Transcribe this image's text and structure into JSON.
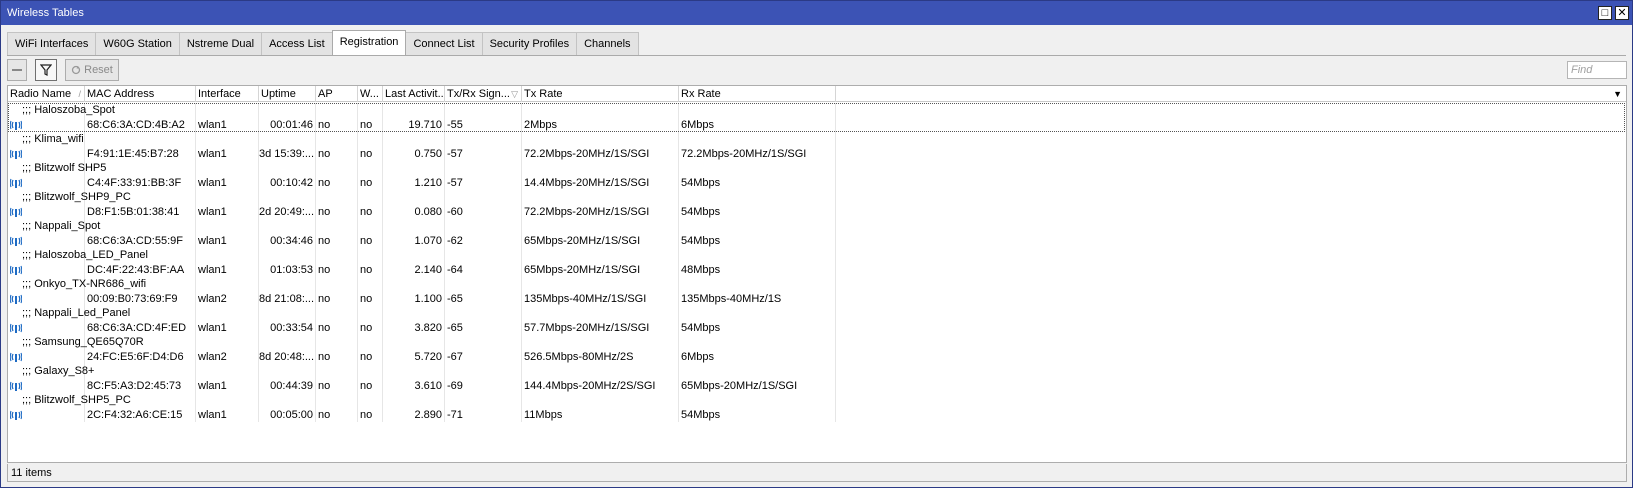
{
  "window": {
    "title": "Wireless Tables"
  },
  "tabs": [
    {
      "label": "WiFi Interfaces",
      "active": false
    },
    {
      "label": "W60G Station",
      "active": false
    },
    {
      "label": "Nstreme Dual",
      "active": false
    },
    {
      "label": "Access List",
      "active": false
    },
    {
      "label": "Registration",
      "active": true
    },
    {
      "label": "Connect List",
      "active": false
    },
    {
      "label": "Security Profiles",
      "active": false
    },
    {
      "label": "Channels",
      "active": false
    }
  ],
  "toolbar": {
    "reset_label": "Reset",
    "find_placeholder": "Find"
  },
  "columns": [
    "Radio Name",
    "MAC Address",
    "Interface",
    "Uptime",
    "AP",
    "W...",
    "Last Activit...",
    "Tx/Rx Sign...",
    "Tx Rate",
    "Rx Rate"
  ],
  "rows": [
    {
      "comment": ";;; Haloszoba_Spot",
      "mac": "68:C6:3A:CD:4B:A2",
      "iface": "wlan1",
      "uptime": "00:01:46",
      "ap": "no",
      "w": "no",
      "last": "19.710",
      "signal": "-55",
      "tx": "2Mbps",
      "rx": "6Mbps"
    },
    {
      "comment": ";;; Klima_wifi",
      "mac": "F4:91:1E:45:B7:28",
      "iface": "wlan1",
      "uptime": "3d 15:39:...",
      "ap": "no",
      "w": "no",
      "last": "0.750",
      "signal": "-57",
      "tx": "72.2Mbps-20MHz/1S/SGI",
      "rx": "72.2Mbps-20MHz/1S/SGI"
    },
    {
      "comment": ";;; Blitzwolf SHP5",
      "mac": "C4:4F:33:91:BB:3F",
      "iface": "wlan1",
      "uptime": "00:10:42",
      "ap": "no",
      "w": "no",
      "last": "1.210",
      "signal": "-57",
      "tx": "14.4Mbps-20MHz/1S/SGI",
      "rx": "54Mbps"
    },
    {
      "comment": ";;; Blitzwolf_SHP9_PC",
      "mac": "D8:F1:5B:01:38:41",
      "iface": "wlan1",
      "uptime": "2d 20:49:...",
      "ap": "no",
      "w": "no",
      "last": "0.080",
      "signal": "-60",
      "tx": "72.2Mbps-20MHz/1S/SGI",
      "rx": "54Mbps"
    },
    {
      "comment": ";;; Nappali_Spot",
      "mac": "68:C6:3A:CD:55:9F",
      "iface": "wlan1",
      "uptime": "00:34:46",
      "ap": "no",
      "w": "no",
      "last": "1.070",
      "signal": "-62",
      "tx": "65Mbps-20MHz/1S/SGI",
      "rx": "54Mbps"
    },
    {
      "comment": ";;; Haloszoba_LED_Panel",
      "mac": "DC:4F:22:43:BF:AA",
      "iface": "wlan1",
      "uptime": "01:03:53",
      "ap": "no",
      "w": "no",
      "last": "2.140",
      "signal": "-64",
      "tx": "65Mbps-20MHz/1S/SGI",
      "rx": "48Mbps"
    },
    {
      "comment": ";;; Onkyo_TX-NR686_wifi",
      "mac": "00:09:B0:73:69:F9",
      "iface": "wlan2",
      "uptime": "8d 21:08:...",
      "ap": "no",
      "w": "no",
      "last": "1.100",
      "signal": "-65",
      "tx": "135Mbps-40MHz/1S/SGI",
      "rx": "135Mbps-40MHz/1S"
    },
    {
      "comment": ";;; Nappali_Led_Panel",
      "mac": "68:C6:3A:CD:4F:ED",
      "iface": "wlan1",
      "uptime": "00:33:54",
      "ap": "no",
      "w": "no",
      "last": "3.820",
      "signal": "-65",
      "tx": "57.7Mbps-20MHz/1S/SGI",
      "rx": "54Mbps"
    },
    {
      "comment": ";;; Samsung_QE65Q70R",
      "mac": "24:FC:E5:6F:D4:D6",
      "iface": "wlan2",
      "uptime": "8d 20:48:...",
      "ap": "no",
      "w": "no",
      "last": "5.720",
      "signal": "-67",
      "tx": "526.5Mbps-80MHz/2S",
      "rx": "6Mbps"
    },
    {
      "comment": ";;; Galaxy_S8+",
      "mac": "8C:F5:A3:D2:45:73",
      "iface": "wlan1",
      "uptime": "00:44:39",
      "ap": "no",
      "w": "no",
      "last": "3.610",
      "signal": "-69",
      "tx": "144.4Mbps-20MHz/2S/SGI",
      "rx": "65Mbps-20MHz/1S/SGI"
    },
    {
      "comment": ";;; Blitzwolf_SHP5_PC",
      "mac": "2C:F4:32:A6:CE:15",
      "iface": "wlan1",
      "uptime": "00:05:00",
      "ap": "no",
      "w": "no",
      "last": "2.890",
      "signal": "-71",
      "tx": "11Mbps",
      "rx": "54Mbps"
    }
  ],
  "status": {
    "count_label": "11 items"
  },
  "icons": {
    "minimize": "restore-icon",
    "close": "close-icon",
    "row": "wireless-client-icon",
    "filter": "filter-icon",
    "reset": "reset-icon",
    "remove": "minus-icon"
  },
  "colors": {
    "titlebar": "#3c53b5",
    "icon": "#1e6bc4"
  }
}
